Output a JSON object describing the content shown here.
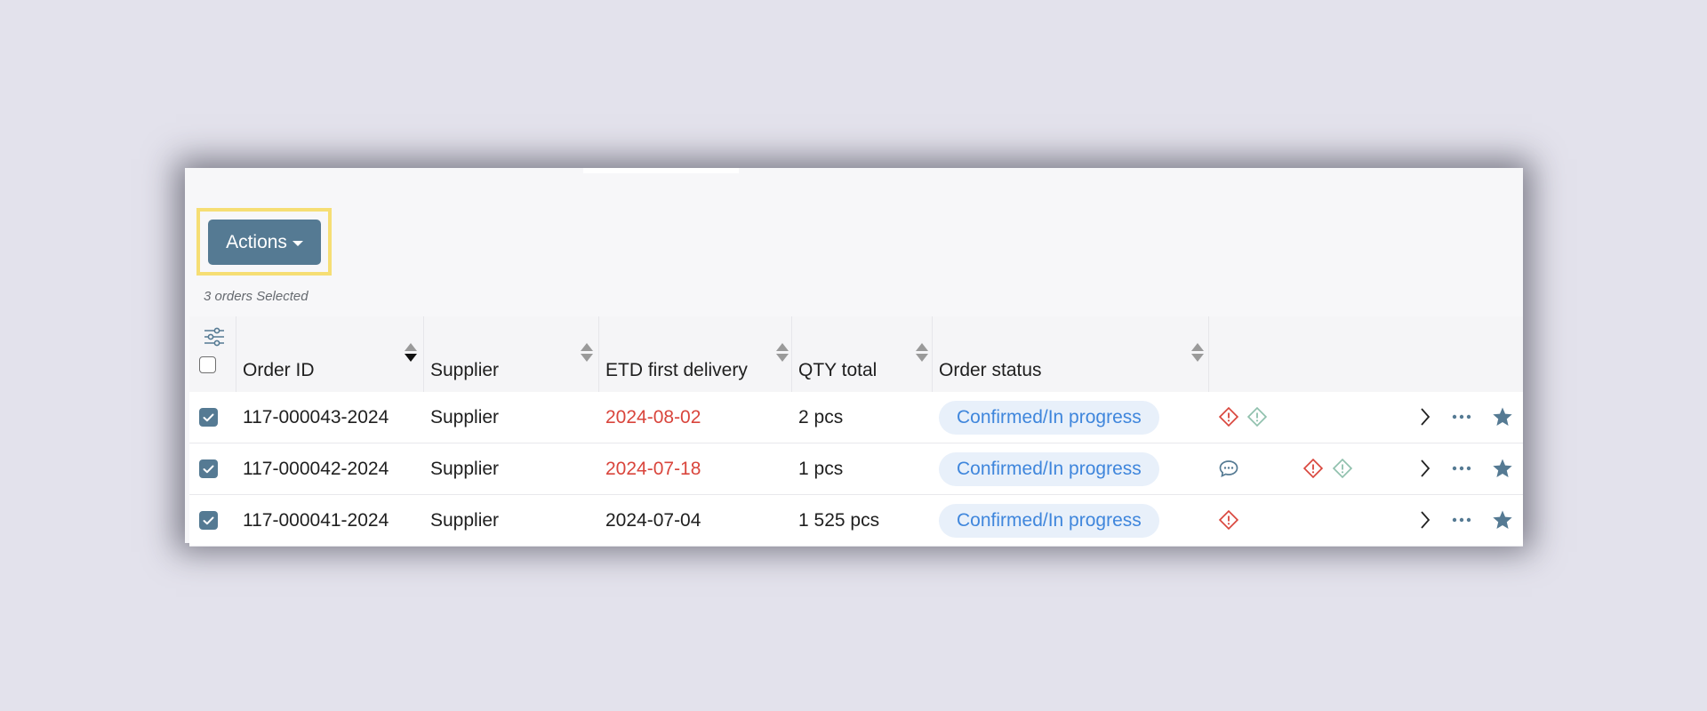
{
  "toolbar": {
    "actions_label": "Actions",
    "selected_text": "3 orders Selected"
  },
  "table": {
    "columns": [
      {
        "key": "order_id",
        "label": "Order ID",
        "sort": "desc"
      },
      {
        "key": "supplier",
        "label": "Supplier",
        "sort": "none"
      },
      {
        "key": "etd",
        "label": "ETD first delivery",
        "sort": "none"
      },
      {
        "key": "qty",
        "label": "QTY total",
        "sort": "none"
      },
      {
        "key": "status",
        "label": "Order status",
        "sort": "none"
      }
    ],
    "rows": [
      {
        "checked": true,
        "order_id": "117-000043-2024",
        "supplier": "Supplier",
        "etd": "2024-08-02",
        "etd_overdue": true,
        "qty": "2 pcs",
        "status": "Confirmed/In progress",
        "icons": [
          "alert-red-icon",
          "alert-green-icon"
        ]
      },
      {
        "checked": true,
        "order_id": "117-000042-2024",
        "supplier": "Supplier",
        "etd": "2024-07-18",
        "etd_overdue": true,
        "qty": "1 pcs",
        "status": "Confirmed/In progress",
        "icons": [
          "chat-icon",
          "alert-red-icon",
          "alert-green-icon"
        ]
      },
      {
        "checked": true,
        "order_id": "117-000041-2024",
        "supplier": "Supplier",
        "etd": "2024-07-04",
        "etd_overdue": false,
        "qty": "1 525 pcs",
        "status": "Confirmed/In progress",
        "icons": [
          "alert-red-icon"
        ]
      }
    ]
  },
  "colors": {
    "primary": "#557a93",
    "overdue": "#d9453c",
    "status_text": "#3f86dc",
    "status_bg": "#e8f0fa",
    "alert_red": "#d9453c",
    "alert_green": "#8fc0ad",
    "highlight": "#f6de74"
  }
}
